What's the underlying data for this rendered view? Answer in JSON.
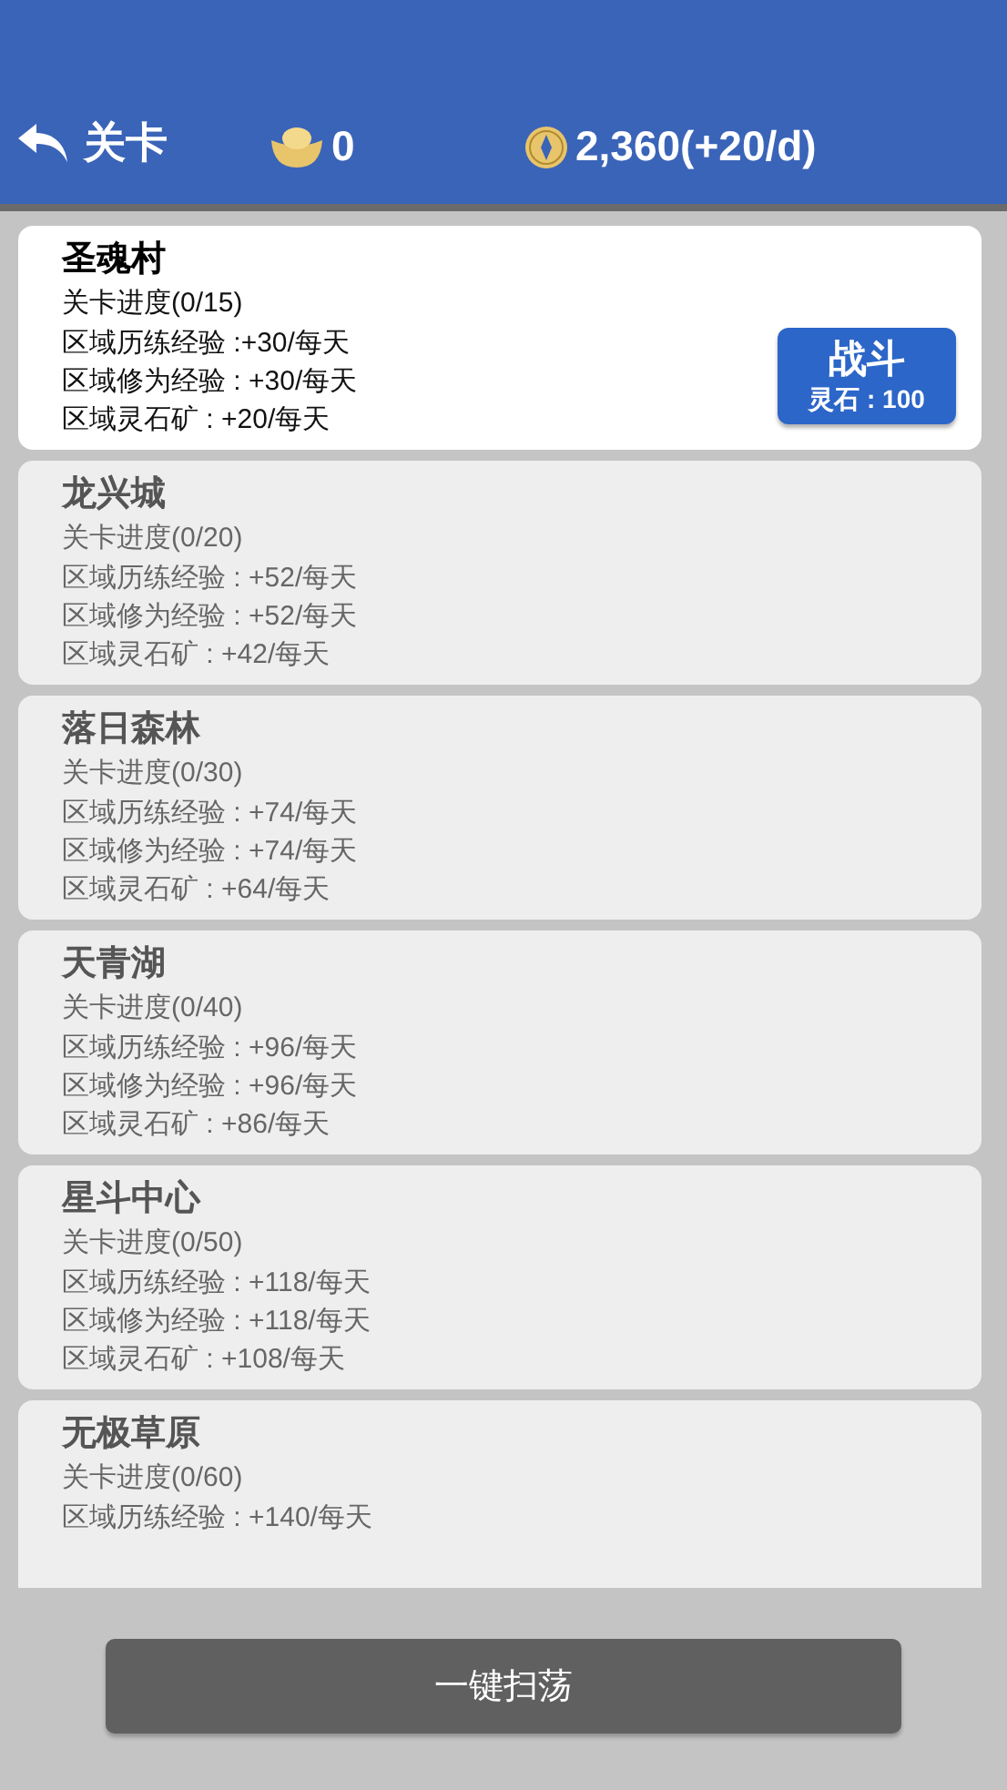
{
  "header": {
    "back_label": "关卡",
    "ingot_count": "0",
    "coins": "2,360(+20/d)"
  },
  "stages": [
    {
      "name": "圣魂村",
      "unlocked": true,
      "lines": [
        "关卡进度(0/15)",
        "区域历练经验 :+30/每天",
        "区域修为经验 : +30/每天",
        "区域灵石矿 : +20/每天"
      ],
      "battle": {
        "label": "战斗",
        "cost": "灵石 : 100"
      }
    },
    {
      "name": "龙兴城",
      "unlocked": false,
      "lines": [
        "关卡进度(0/20)",
        "区域历练经验 : +52/每天",
        "区域修为经验 : +52/每天",
        "区域灵石矿 : +42/每天"
      ]
    },
    {
      "name": "落日森林",
      "unlocked": false,
      "lines": [
        "关卡进度(0/30)",
        "区域历练经验 : +74/每天",
        "区域修为经验 : +74/每天",
        "区域灵石矿 : +64/每天"
      ]
    },
    {
      "name": "天青湖",
      "unlocked": false,
      "lines": [
        "关卡进度(0/40)",
        "区域历练经验 : +96/每天",
        "区域修为经验 : +96/每天",
        "区域灵石矿 : +86/每天"
      ]
    },
    {
      "name": "星斗中心",
      "unlocked": false,
      "lines": [
        "关卡进度(0/50)",
        "区域历练经验 : +118/每天",
        "区域修为经验 : +118/每天",
        "区域灵石矿 : +108/每天"
      ]
    },
    {
      "name": "无极草原",
      "unlocked": false,
      "lines": [
        "关卡进度(0/60)",
        "区域历练经验 : +140/每天"
      ]
    }
  ],
  "sweep_button": "一键扫荡"
}
